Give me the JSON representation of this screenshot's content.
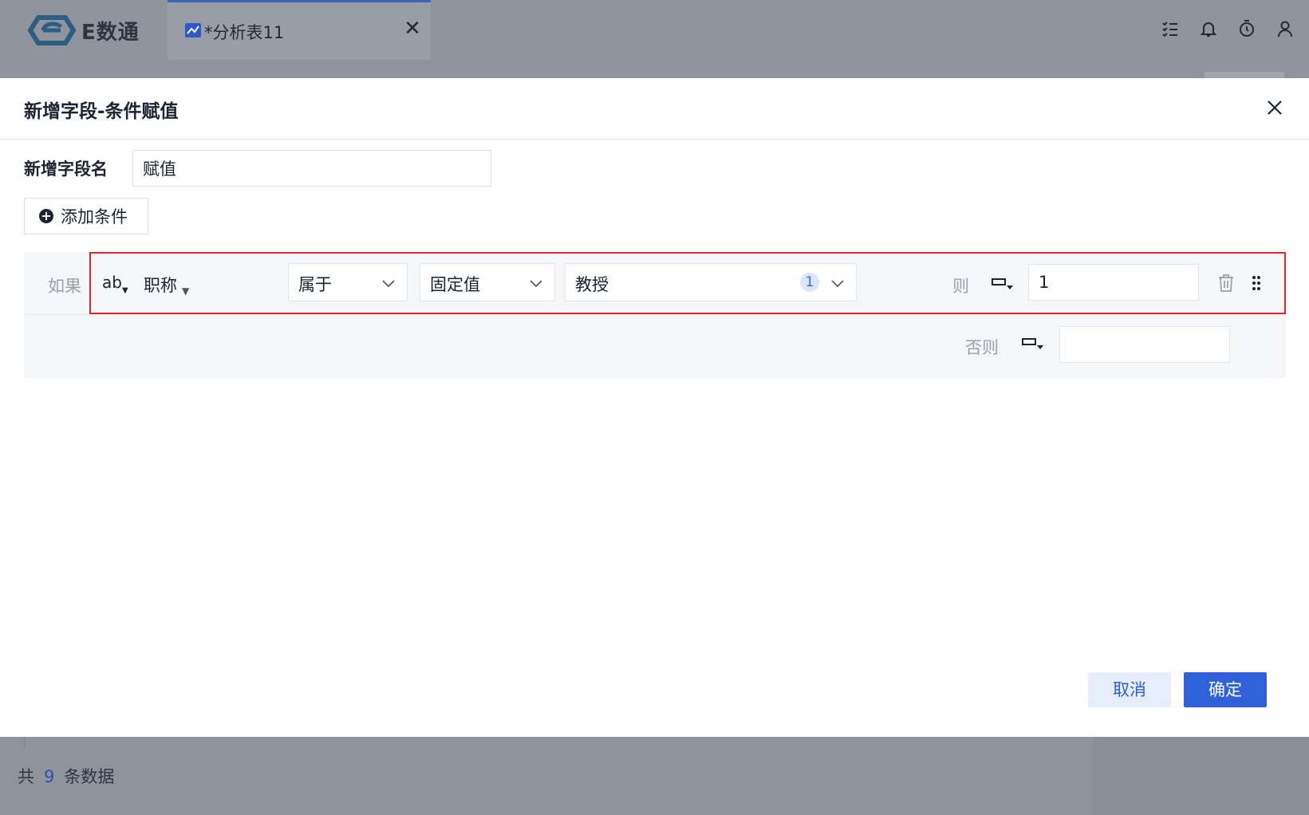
{
  "app": {
    "brand_name": "E数通"
  },
  "tab": {
    "title": "*分析表11",
    "close": "✕"
  },
  "top_icons": [
    "task-list-icon",
    "bell-icon",
    "timer-icon",
    "user-icon"
  ],
  "background": {
    "footer_prefix": "共",
    "footer_count": "9",
    "footer_suffix": "条数据"
  },
  "modal": {
    "title": "新增字段-条件赋值",
    "field_label": "新增字段名",
    "field_value": "赋值",
    "add_condition": "添加条件",
    "condition": {
      "if_label": "如果",
      "field_type": "ab",
      "field_name": "职称",
      "operator": "属于",
      "value_type": "固定值",
      "value": "教授",
      "value_count": "1",
      "then_label": "则",
      "then_value": "1"
    },
    "else_label": "否则",
    "else_value": "",
    "cancel": "取消",
    "confirm": "确定"
  },
  "colors": {
    "primary": "#2f62da",
    "highlight_border": "#e0272f",
    "overlay": "#8e939c"
  }
}
